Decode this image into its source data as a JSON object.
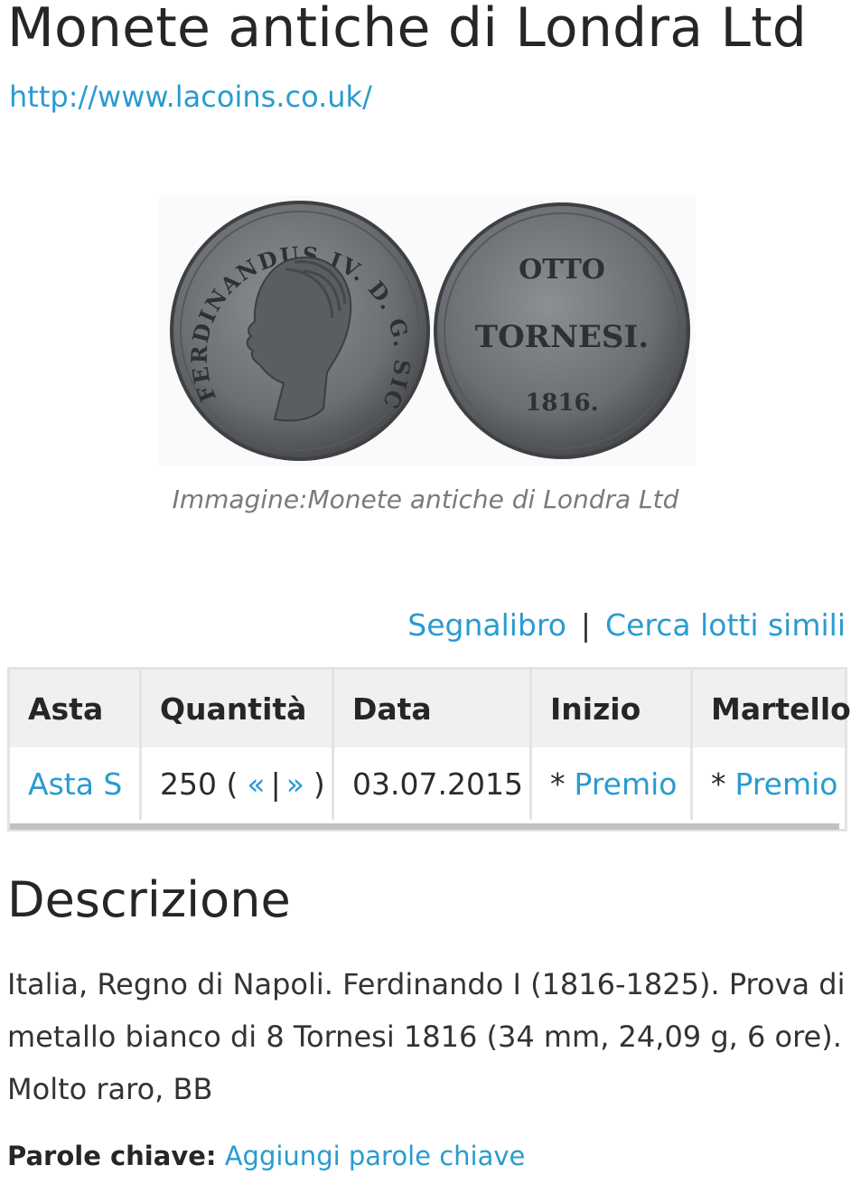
{
  "page": {
    "title": "Monete antiche di Londra Ltd",
    "site_url": "http://www.lacoins.co.uk/"
  },
  "image": {
    "caption": "Immagine:Monete antiche di Londra Ltd",
    "obverse_legend": "FERDINANDUS IV. D. G. SICIL. REX",
    "reverse_line1": "OTTO",
    "reverse_line2": "TORNESI.",
    "reverse_year": "1816."
  },
  "actions": {
    "bookmark": "Segnalibro",
    "separator": "|",
    "similar": "Cerca lotti simili"
  },
  "lot_table": {
    "headers": [
      "Asta",
      "Quantità",
      "Data",
      "Inizio",
      "Martello"
    ],
    "row": {
      "auction": "Asta S",
      "quantity_prefix": "250 (",
      "prev": "«",
      "divider": "|",
      "next": "»",
      "quantity_suffix": ")",
      "date": "03.07.2015",
      "start_star": "*",
      "start_link": "Premio",
      "hammer_star": "*",
      "hammer_link": "Premio"
    }
  },
  "description": {
    "heading": "Descrizione",
    "text": "Italia, Regno di Napoli. Ferdinando I (1816-1825). Prova di metallo bianco di 8 Tornesi 1816 (34 mm, 24,09 g, 6 ore). Molto raro, BB"
  },
  "keywords": {
    "label": "Parole chiave:",
    "link": "Aggiungi parole chiave"
  },
  "colors": {
    "link": "#2a9bd0",
    "table_header_bg": "#f0f0f0",
    "coin_metal": "#6d7074"
  }
}
